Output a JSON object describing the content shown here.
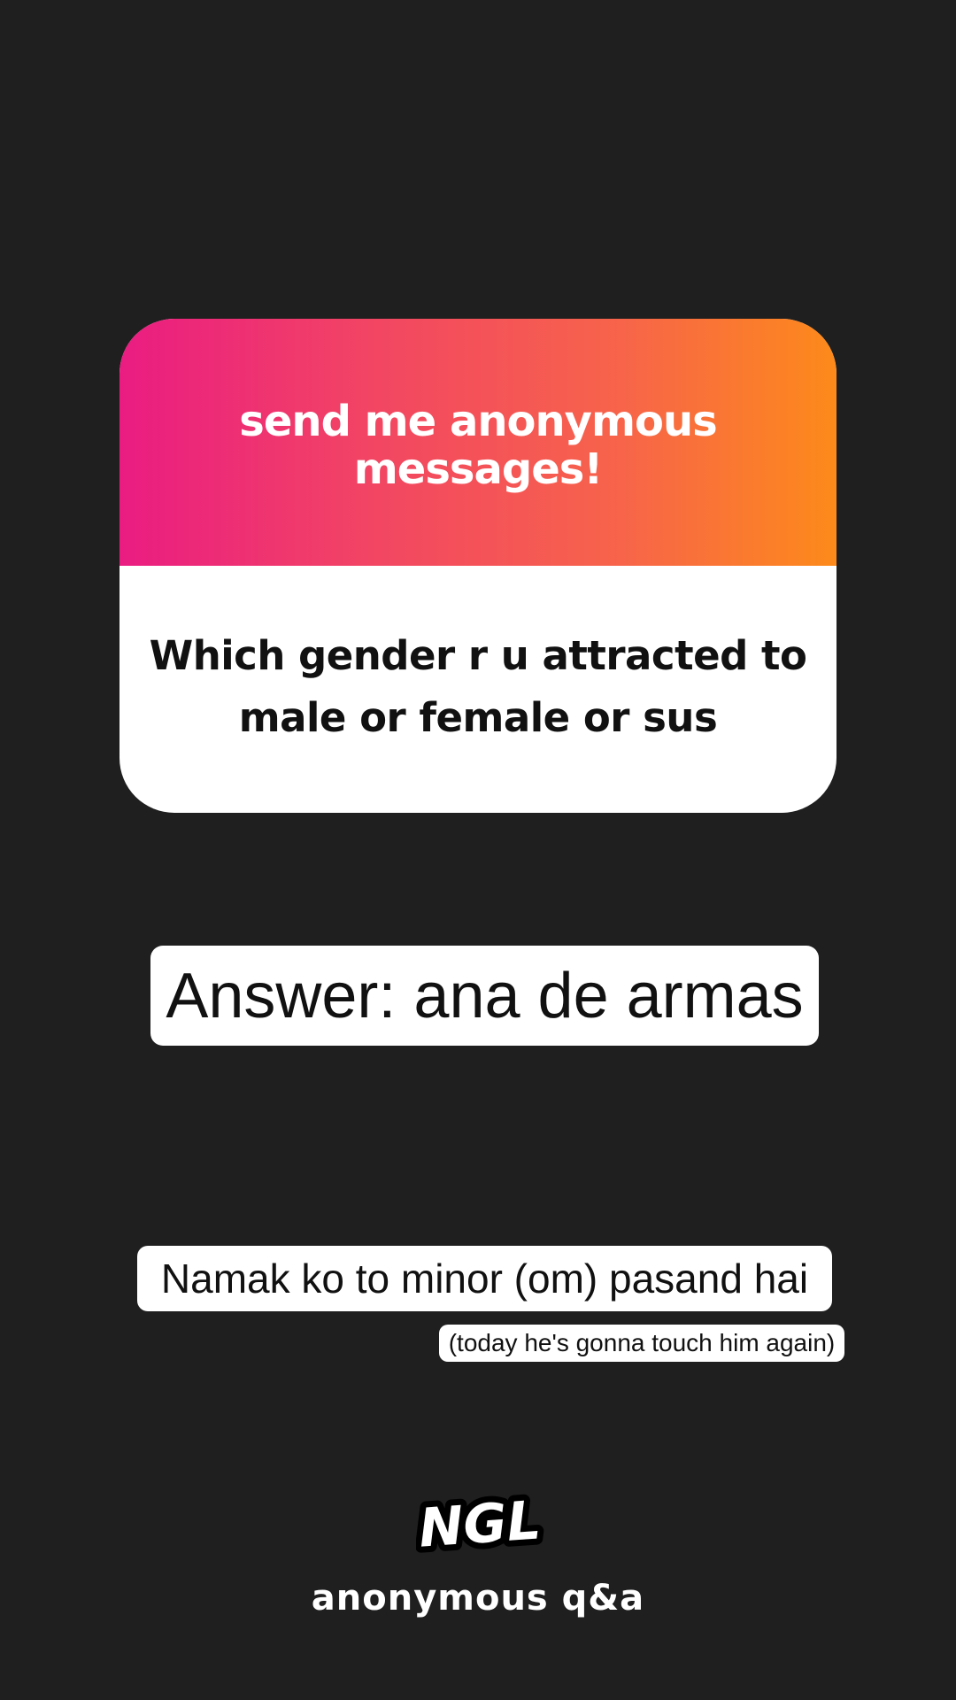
{
  "card": {
    "header_text": "send me anonymous messages!",
    "question": "Which gender r u attracted to male or female or sus",
    "gradient_colors": [
      "#ea1c82",
      "#f24563",
      "#f7644a",
      "#fd8a1a"
    ]
  },
  "answer": {
    "text": "Answer: ana de armas"
  },
  "caption": {
    "main": "Namak ko to minor (om) pasand hai",
    "sub": "(today he's gonna touch him again)"
  },
  "footer": {
    "logo_text": "NGL",
    "tagline": "anonymous q&a"
  },
  "colors": {
    "background": "#1f1f1f",
    "card_body": "#ffffff",
    "text_dark": "#111111"
  }
}
